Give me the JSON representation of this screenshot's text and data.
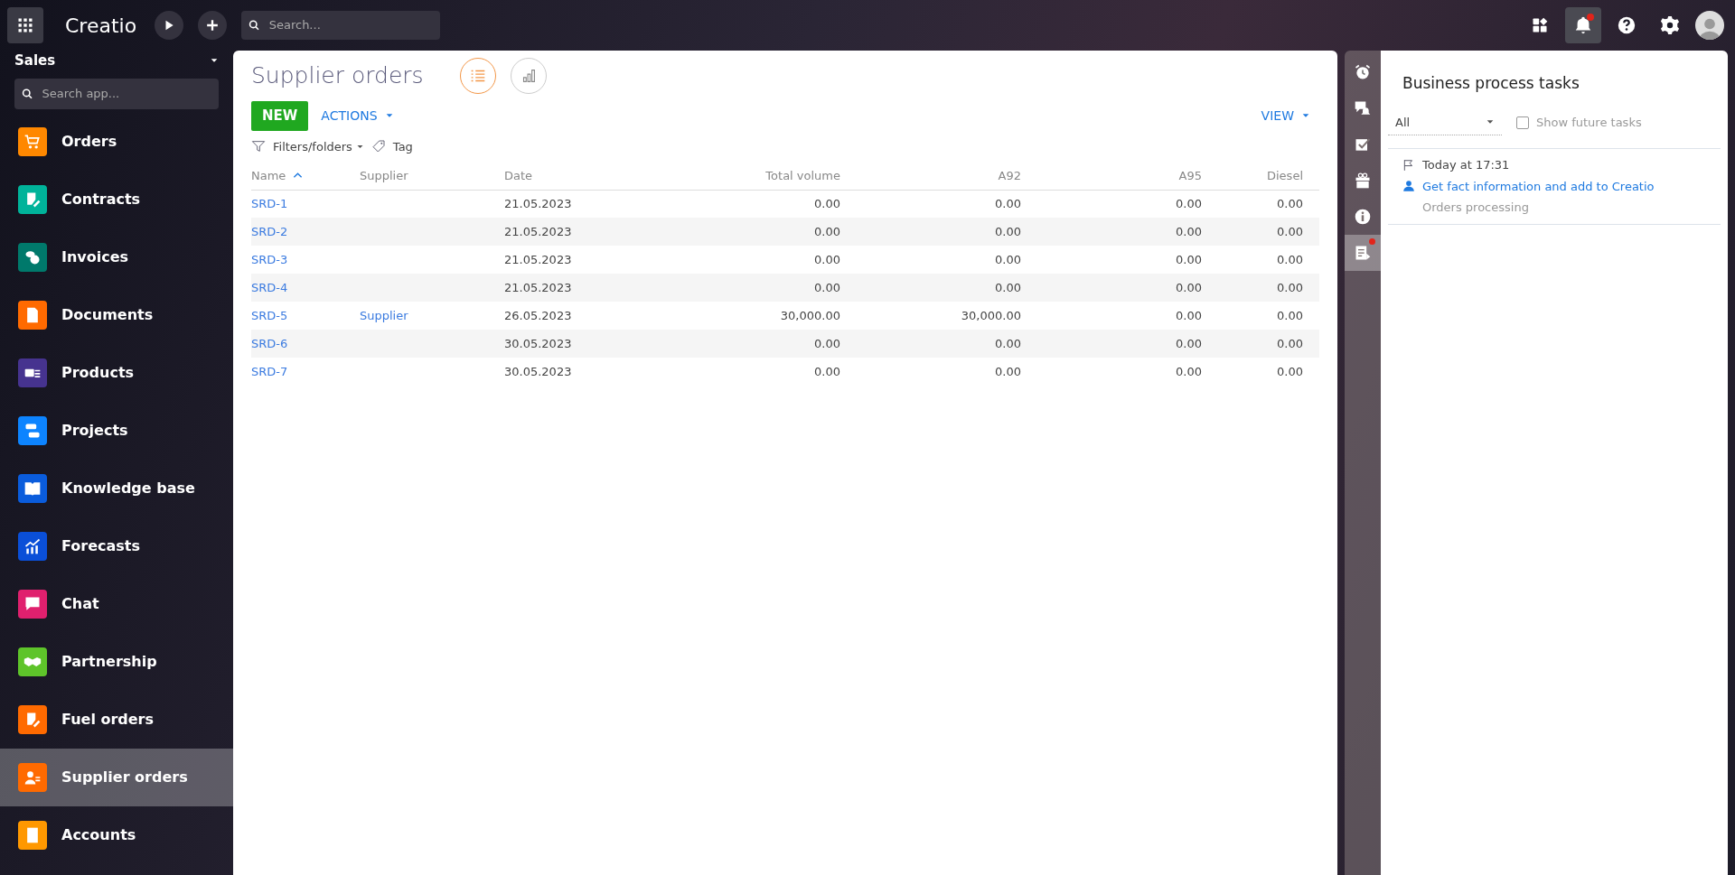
{
  "topbar": {
    "logo": "Creatio",
    "search": {
      "placeholder": "Search..."
    },
    "bell_has_dot": true
  },
  "sidebar": {
    "workspace": "Sales",
    "search": {
      "placeholder": "Search app..."
    },
    "items": [
      {
        "label": "Orders",
        "color": "#ff8800",
        "selected": false
      },
      {
        "label": "Contracts",
        "color": "#00b39a",
        "selected": false
      },
      {
        "label": "Invoices",
        "color": "#00796b",
        "selected": false
      },
      {
        "label": "Documents",
        "color": "#ff6a00",
        "selected": false
      },
      {
        "label": "Products",
        "color": "#46338f",
        "selected": false
      },
      {
        "label": "Projects",
        "color": "#0d84ff",
        "selected": false
      },
      {
        "label": "Knowledge base",
        "color": "#0a5cdc",
        "selected": false
      },
      {
        "label": "Forecasts",
        "color": "#0a4fd8",
        "selected": false
      },
      {
        "label": "Chat",
        "color": "#e0206e",
        "selected": false
      },
      {
        "label": "Partnership",
        "color": "#5ec42a",
        "selected": false
      },
      {
        "label": "Fuel orders",
        "color": "#ff6a00",
        "selected": false
      },
      {
        "label": "Supplier orders",
        "color": "#ff6a00",
        "selected": true
      },
      {
        "label": "Accounts",
        "color": "#ff9800",
        "selected": false
      }
    ]
  },
  "page": {
    "title": "Supplier orders",
    "views": [
      {
        "kind": "list",
        "selected": true
      },
      {
        "kind": "chart",
        "selected": false
      }
    ],
    "new_button": "NEW",
    "actions_button": "ACTIONS",
    "view_button": "VIEW",
    "filters": "Filters/folders",
    "tag": "Tag",
    "table": {
      "columns": [
        {
          "label": "Name",
          "kind": "link",
          "sorted": true
        },
        {
          "label": "Supplier",
          "kind": "link",
          "sorted": false
        },
        {
          "label": "Date",
          "kind": "text",
          "sorted": false
        },
        {
          "label": "Total volume",
          "kind": "number",
          "sorted": false
        },
        {
          "label": "A92",
          "kind": "number",
          "sorted": false
        },
        {
          "label": "A95",
          "kind": "number",
          "sorted": false
        },
        {
          "label": "Diesel",
          "kind": "number",
          "sorted": false
        }
      ],
      "rows": [
        [
          "SRD-1",
          null,
          "21.05.2023",
          "0.00",
          "0.00",
          "0.00",
          "0.00"
        ],
        [
          "SRD-2",
          null,
          "21.05.2023",
          "0.00",
          "0.00",
          "0.00",
          "0.00"
        ],
        [
          "SRD-3",
          null,
          "21.05.2023",
          "0.00",
          "0.00",
          "0.00",
          "0.00"
        ],
        [
          "SRD-4",
          null,
          "21.05.2023",
          "0.00",
          "0.00",
          "0.00",
          "0.00"
        ],
        [
          "SRD-5",
          "Supplier",
          "26.05.2023",
          "30,000.00",
          "30,000.00",
          "0.00",
          "0.00"
        ],
        [
          "SRD-6",
          null,
          "30.05.2023",
          "0.00",
          "0.00",
          "0.00",
          "0.00"
        ],
        [
          "SRD-7",
          null,
          "30.05.2023",
          "0.00",
          "0.00",
          "0.00",
          "0.00"
        ]
      ]
    }
  },
  "rail": [
    {
      "selected": false,
      "has_dot": false
    },
    {
      "selected": false,
      "has_dot": false
    },
    {
      "selected": false,
      "has_dot": false
    },
    {
      "selected": false,
      "has_dot": false
    },
    {
      "selected": false,
      "has_dot": false
    },
    {
      "selected": true,
      "has_dot": true
    }
  ],
  "tasks_panel": {
    "title": "Business process tasks",
    "filter": "All",
    "show_future": {
      "label": "Show future tasks",
      "checked": false
    },
    "tasks": [
      {
        "time": "Today at 17:31",
        "title": "Get fact information and add to Creatio",
        "process": "Orders processing"
      }
    ]
  }
}
